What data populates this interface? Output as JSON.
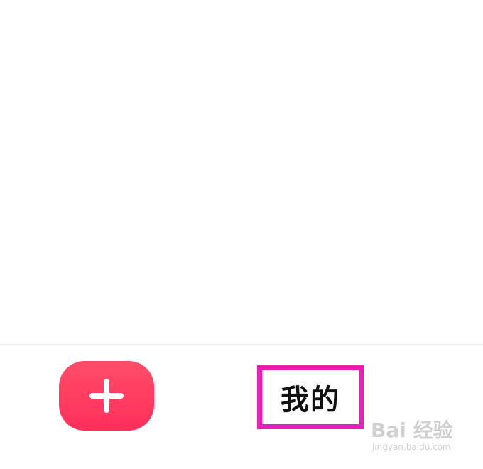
{
  "tab_bar": {
    "add_icon": "plus-icon",
    "add_button_color": "#ff3b61",
    "me_label": "我的",
    "highlight_color": "#e81eb5"
  },
  "watermark": {
    "main": "Bai 经验",
    "sub": "jingyan.baidu.com"
  }
}
